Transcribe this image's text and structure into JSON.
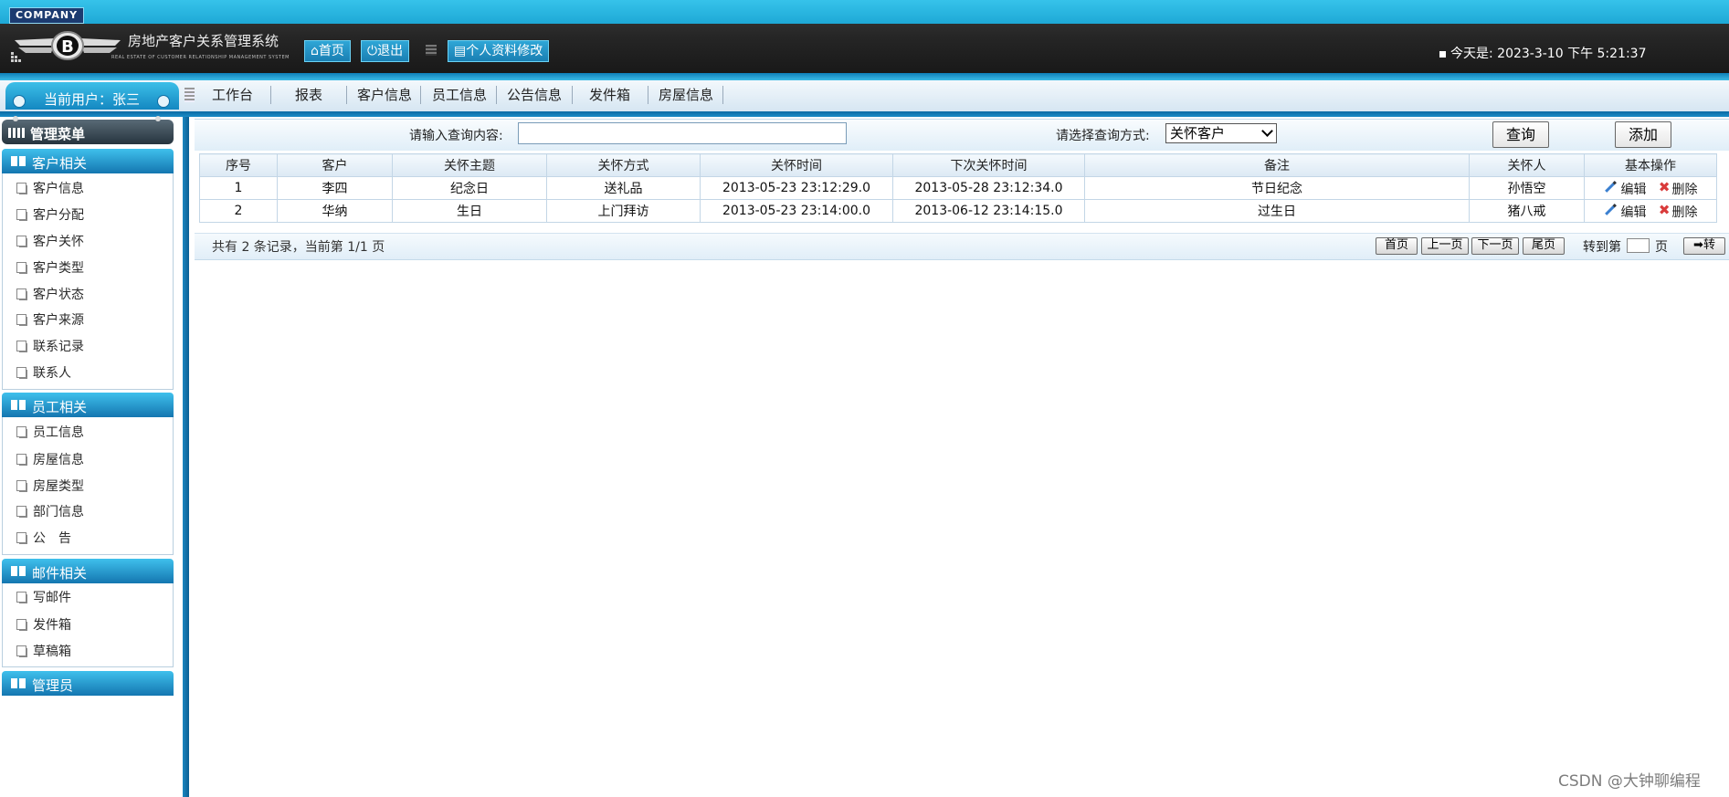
{
  "header": {
    "company_badge": "COMPANY",
    "system_title": "房地产客户关系管理系统",
    "system_subtitle": "REAL ESTATE OF CUSTOMER RELATIONSHIP MANAGEMENT SYSTEM",
    "buttons": {
      "home": "首页",
      "logout": "退出",
      "profile": "个人资料修改"
    },
    "today_label": "今天是:",
    "today_value": "2023-3-10 下午 5:21:37"
  },
  "user": {
    "current_user": "当前用户：张三"
  },
  "nav": {
    "items": [
      "工作台",
      "报表",
      "客户信息",
      "员工信息",
      "公告信息",
      "发件箱",
      "房屋信息"
    ]
  },
  "sidebar": {
    "title": "管理菜单",
    "groups": [
      {
        "label": "客户相关",
        "items": [
          "客户信息",
          "客户分配",
          "客户关怀",
          "客户类型",
          "客户状态",
          "客户来源",
          "联系记录",
          "联系人"
        ]
      },
      {
        "label": "员工相关",
        "items": [
          "员工信息",
          "房屋信息",
          "房屋类型",
          "部门信息",
          "公　告"
        ]
      },
      {
        "label": "邮件相关",
        "items": [
          "写邮件",
          "发件箱",
          "草稿箱"
        ]
      },
      {
        "label": "管理员",
        "items": []
      }
    ]
  },
  "search": {
    "input_label": "请输入查询内容:",
    "input_value": "",
    "method_label": "请选择查询方式:",
    "method_selected": "关怀客户",
    "query_button": "查询",
    "add_button": "添加"
  },
  "table": {
    "columns": [
      "序号",
      "客户",
      "关怀主题",
      "关怀方式",
      "关怀时间",
      "下次关怀时间",
      "备注",
      "关怀人",
      "基本操作"
    ],
    "rows": [
      [
        "1",
        "李四",
        "纪念日",
        "送礼品",
        "2013-05-23 23:12:29.0",
        "2013-05-28 23:12:34.0",
        "节日纪念",
        "孙悟空"
      ],
      [
        "2",
        "华纳",
        "生日",
        "上门拜访",
        "2013-05-23 23:14:00.0",
        "2013-06-12 23:14:15.0",
        "过生日",
        "猪八戒"
      ]
    ],
    "edit_label": "编辑",
    "delete_label": "删除"
  },
  "pager": {
    "info": "共有 2 条记录，当前第 1/1 页",
    "first": "首页",
    "prev": "上一页",
    "next": "下一页",
    "last": "尾页",
    "goto_prefix": "转到第",
    "goto_suffix": "页",
    "goto_button": "➡转"
  },
  "watermark": "CSDN @大钟聊编程"
}
